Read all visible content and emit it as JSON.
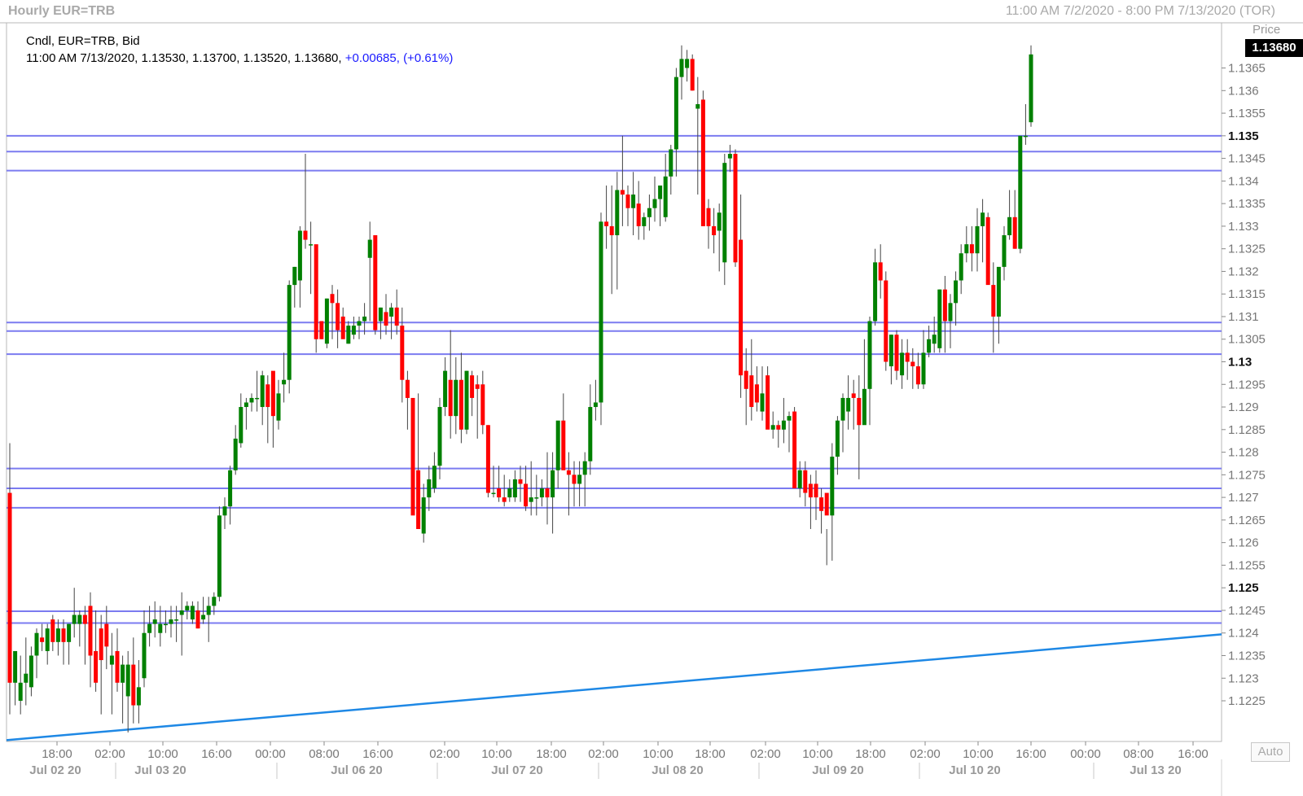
{
  "header": {
    "title": "Hourly EUR=TRB",
    "range": "11:00 AM 7/2/2020 - 8:00 PM 7/13/2020 (TOR)"
  },
  "legend": {
    "line1": "Cndl, EUR=TRB, Bid",
    "line2_prefix": "11:00 AM 7/13/2020, 1.13530, 1.13700, 1.13520, 1.13680,",
    "change": "+0.00685,",
    "change_pct": "(+0.61%)"
  },
  "axis": {
    "price_label": "Price",
    "last_price": "1.13680",
    "auto_button": "Auto"
  },
  "colors": {
    "up": "#008000",
    "down": "#ff0000",
    "hline": "#7b7bf0",
    "trendline": "#1e88e5"
  },
  "chart_data": {
    "type": "candlestick",
    "symbol": "EUR=TRB",
    "interval": "Hourly",
    "ylim": [
      1.1216,
      1.1375
    ],
    "y_ticks": [
      {
        "v": 1.1225,
        "label": "1.1225",
        "bold": false
      },
      {
        "v": 1.123,
        "label": "1.123",
        "bold": false
      },
      {
        "v": 1.1235,
        "label": "1.1235",
        "bold": false
      },
      {
        "v": 1.124,
        "label": "1.124",
        "bold": false
      },
      {
        "v": 1.1245,
        "label": "1.1245",
        "bold": false
      },
      {
        "v": 1.125,
        "label": "1.125",
        "bold": true
      },
      {
        "v": 1.1255,
        "label": "1.1255",
        "bold": false
      },
      {
        "v": 1.126,
        "label": "1.126",
        "bold": false
      },
      {
        "v": 1.1265,
        "label": "1.1265",
        "bold": false
      },
      {
        "v": 1.127,
        "label": "1.127",
        "bold": false
      },
      {
        "v": 1.1275,
        "label": "1.1275",
        "bold": false
      },
      {
        "v": 1.128,
        "label": "1.128",
        "bold": false
      },
      {
        "v": 1.1285,
        "label": "1.1285",
        "bold": false
      },
      {
        "v": 1.129,
        "label": "1.129",
        "bold": false
      },
      {
        "v": 1.1295,
        "label": "1.1295",
        "bold": false
      },
      {
        "v": 1.13,
        "label": "1.13",
        "bold": true
      },
      {
        "v": 1.1305,
        "label": "1.1305",
        "bold": false
      },
      {
        "v": 1.131,
        "label": "1.131",
        "bold": false
      },
      {
        "v": 1.1315,
        "label": "1.1315",
        "bold": false
      },
      {
        "v": 1.132,
        "label": "1.132",
        "bold": false
      },
      {
        "v": 1.1325,
        "label": "1.1325",
        "bold": false
      },
      {
        "v": 1.133,
        "label": "1.133",
        "bold": false
      },
      {
        "v": 1.1335,
        "label": "1.1335",
        "bold": false
      },
      {
        "v": 1.134,
        "label": "1.134",
        "bold": false
      },
      {
        "v": 1.1345,
        "label": "1.1345",
        "bold": false
      },
      {
        "v": 1.135,
        "label": "1.135",
        "bold": true
      },
      {
        "v": 1.1355,
        "label": "1.1355",
        "bold": false
      },
      {
        "v": 1.136,
        "label": "1.136",
        "bold": false
      },
      {
        "v": 1.1365,
        "label": "1.1365",
        "bold": false
      }
    ],
    "x_time_labels": [
      "18:00",
      "02:00",
      "10:00",
      "16:00",
      "00:00",
      "08:00",
      "16:00",
      "02:00",
      "10:00",
      "18:00",
      "02:00",
      "10:00",
      "18:00",
      "02:00",
      "10:00",
      "18:00",
      "02:00",
      "10:00",
      "16:00",
      "00:00",
      "08:00",
      "16:00"
    ],
    "x_date_labels": [
      "Jul 02 20",
      "Jul 03 20",
      "Jul 06 20",
      "Jul 07 20",
      "Jul 08 20",
      "Jul 09 20",
      "Jul 10 20",
      "Jul 13 20"
    ],
    "horizontal_levels": [
      1.135,
      1.13465,
      1.13423,
      1.13087,
      1.13068,
      1.13017,
      1.12764,
      1.1272,
      1.12677,
      1.12448,
      1.12422
    ],
    "trendline": {
      "start": 1.12163,
      "end": 1.12397
    },
    "candles": [
      [
        1.1271,
        1.1282,
        1.1222,
        1.1229
      ],
      [
        1.1229,
        1.1233,
        1.1224,
        1.1236
      ],
      [
        1.1225,
        1.1235,
        1.1222,
        1.1229
      ],
      [
        1.1229,
        1.1239,
        1.1224,
        1.1231
      ],
      [
        1.1228,
        1.1237,
        1.1226,
        1.1235
      ],
      [
        1.1235,
        1.1241,
        1.123,
        1.124
      ],
      [
        1.1239,
        1.1242,
        1.1236,
        1.1238
      ],
      [
        1.1236,
        1.1242,
        1.1233,
        1.1241
      ],
      [
        1.1243,
        1.1244,
        1.1236,
        1.1238
      ],
      [
        1.1238,
        1.1243,
        1.1235,
        1.1241
      ],
      [
        1.1241,
        1.1243,
        1.1233,
        1.1238
      ],
      [
        1.1238,
        1.1242,
        1.1233,
        1.1242
      ],
      [
        1.1242,
        1.125,
        1.1239,
        1.1244
      ],
      [
        1.1242,
        1.1245,
        1.1237,
        1.1244
      ],
      [
        1.1244,
        1.1246,
        1.1233,
        1.1242
      ],
      [
        1.1246,
        1.1249,
        1.1228,
        1.1235
      ],
      [
        1.1236,
        1.1245,
        1.1227,
        1.1229
      ],
      [
        1.1241,
        1.1244,
        1.1222,
        1.1234
      ],
      [
        1.1242,
        1.1246,
        1.1232,
        1.1237
      ],
      [
        1.1233,
        1.124,
        1.1222,
        1.1235
      ],
      [
        1.1236,
        1.1241,
        1.1227,
        1.1229
      ],
      [
        1.1229,
        1.1235,
        1.122,
        1.1233
      ],
      [
        1.1226,
        1.1236,
        1.1218,
        1.1233
      ],
      [
        1.1233,
        1.1239,
        1.122,
        1.1224
      ],
      [
        1.1224,
        1.1234,
        1.122,
        1.1228
      ],
      [
        1.123,
        1.1245,
        1.1228,
        1.124
      ],
      [
        1.124,
        1.1246,
        1.1237,
        1.1242
      ],
      [
        1.1242,
        1.1247,
        1.1239,
        1.1243
      ],
      [
        1.124,
        1.1246,
        1.1237,
        1.1242
      ],
      [
        1.1242,
        1.1245,
        1.124,
        1.1242
      ],
      [
        1.1242,
        1.1246,
        1.1239,
        1.1243
      ],
      [
        1.1243,
        1.1246,
        1.1238,
        1.1243
      ],
      [
        1.1244,
        1.1249,
        1.1235,
        1.1245
      ],
      [
        1.1245,
        1.1247,
        1.1243,
        1.1246
      ],
      [
        1.1243,
        1.1247,
        1.1242,
        1.1246
      ],
      [
        1.1245,
        1.1247,
        1.1241,
        1.1241
      ],
      [
        1.1243,
        1.1248,
        1.1242,
        1.1244
      ],
      [
        1.1244,
        1.1248,
        1.1238,
        1.1246
      ],
      [
        1.1246,
        1.1249,
        1.1244,
        1.1248
      ],
      [
        1.1248,
        1.1268,
        1.1247,
        1.1266
      ],
      [
        1.1266,
        1.127,
        1.1263,
        1.1268
      ],
      [
        1.1268,
        1.1277,
        1.1264,
        1.1276
      ],
      [
        1.1276,
        1.1286,
        1.1275,
        1.1283
      ],
      [
        1.1282,
        1.1293,
        1.1281,
        1.129
      ],
      [
        1.129,
        1.1292,
        1.1285,
        1.1291
      ],
      [
        1.1291,
        1.1293,
        1.1289,
        1.1292
      ],
      [
        1.1292,
        1.1298,
        1.1289,
        1.1292
      ],
      [
        1.129,
        1.1298,
        1.1286,
        1.1297
      ],
      [
        1.1295,
        1.1297,
        1.1282,
        1.129
      ],
      [
        1.1298,
        1.1295,
        1.1281,
        1.1288
      ],
      [
        1.1287,
        1.1296,
        1.1285,
        1.1293
      ],
      [
        1.1295,
        1.1302,
        1.1291,
        1.1296
      ],
      [
        1.1296,
        1.1318,
        1.1293,
        1.1317
      ],
      [
        1.1317,
        1.1321,
        1.1312,
        1.1321
      ],
      [
        1.1318,
        1.133,
        1.1312,
        1.1329
      ],
      [
        1.1329,
        1.1346,
        1.1325,
        1.1327
      ],
      [
        1.1326,
        1.1331,
        1.1315,
        1.1326
      ],
      [
        1.1326,
        1.131,
        1.1302,
        1.1305
      ],
      [
        1.1309,
        1.1309,
        1.1305,
        1.1305
      ],
      [
        1.1304,
        1.1314,
        1.1303,
        1.1314
      ],
      [
        1.1315,
        1.1317,
        1.1305,
        1.1313
      ],
      [
        1.1313,
        1.1316,
        1.1303,
        1.1307
      ],
      [
        1.131,
        1.1312,
        1.1306,
        1.1305
      ],
      [
        1.1304,
        1.1309,
        1.1304,
        1.1308
      ],
      [
        1.1306,
        1.131,
        1.1305,
        1.1308
      ],
      [
        1.1308,
        1.131,
        1.1305,
        1.1309
      ],
      [
        1.1309,
        1.1313,
        1.1306,
        1.131
      ],
      [
        1.1323,
        1.1331,
        1.1309,
        1.1327
      ],
      [
        1.1328,
        1.1326,
        1.1306,
        1.1307
      ],
      [
        1.1309,
        1.1312,
        1.1305,
        1.1312
      ],
      [
        1.1311,
        1.1315,
        1.1306,
        1.1308
      ],
      [
        1.131,
        1.1313,
        1.1305,
        1.1312
      ],
      [
        1.1312,
        1.1316,
        1.1306,
        1.1308
      ],
      [
        1.1308,
        1.1312,
        1.1291,
        1.1296
      ],
      [
        1.1296,
        1.1298,
        1.1285,
        1.1292
      ],
      [
        1.1292,
        1.1287,
        1.1268,
        1.1266
      ],
      [
        1.1276,
        1.1293,
        1.1266,
        1.1263
      ],
      [
        1.1262,
        1.1273,
        1.126,
        1.127
      ],
      [
        1.127,
        1.1277,
        1.1267,
        1.1274
      ],
      [
        1.1272,
        1.128,
        1.1271,
        1.1277
      ],
      [
        1.1277,
        1.1292,
        1.1274,
        1.129
      ],
      [
        1.129,
        1.1301,
        1.1288,
        1.1298
      ],
      [
        1.1296,
        1.1307,
        1.1283,
        1.1288
      ],
      [
        1.1288,
        1.1301,
        1.1284,
        1.1296
      ],
      [
        1.1296,
        1.1302,
        1.1282,
        1.1285
      ],
      [
        1.1285,
        1.1298,
        1.1284,
        1.1298
      ],
      [
        1.1297,
        1.1298,
        1.1288,
        1.1292
      ],
      [
        1.1295,
        1.1297,
        1.1283,
        1.1294
      ],
      [
        1.1295,
        1.1298,
        1.1284,
        1.1286
      ],
      [
        1.1286,
        1.1286,
        1.127,
        1.1271
      ],
      [
        1.1271,
        1.1277,
        1.127,
        1.1271
      ],
      [
        1.1272,
        1.1277,
        1.1269,
        1.127
      ],
      [
        1.127,
        1.1275,
        1.1268,
        1.1269
      ],
      [
        1.127,
        1.1274,
        1.1269,
        1.1272
      ],
      [
        1.127,
        1.1276,
        1.1269,
        1.1274
      ],
      [
        1.1274,
        1.1277,
        1.1269,
        1.1273
      ],
      [
        1.1273,
        1.1277,
        1.1267,
        1.1268
      ],
      [
        1.1269,
        1.1278,
        1.1266,
        1.127
      ],
      [
        1.127,
        1.1275,
        1.1266,
        1.127
      ],
      [
        1.127,
        1.1274,
        1.1268,
        1.1272
      ],
      [
        1.1272,
        1.128,
        1.1264,
        1.127
      ],
      [
        1.127,
        1.128,
        1.1262,
        1.1276
      ],
      [
        1.1276,
        1.1285,
        1.1272,
        1.1287
      ],
      [
        1.1287,
        1.1293,
        1.128,
        1.1276
      ],
      [
        1.1276,
        1.128,
        1.1266,
        1.1275
      ],
      [
        1.1275,
        1.1278,
        1.1268,
        1.1273
      ],
      [
        1.1273,
        1.1278,
        1.1268,
        1.1275
      ],
      [
        1.1275,
        1.128,
        1.1268,
        1.1278
      ],
      [
        1.1278,
        1.1295,
        1.1275,
        1.129
      ],
      [
        1.129,
        1.1296,
        1.1287,
        1.1291
      ],
      [
        1.1291,
        1.1333,
        1.1286,
        1.1331
      ],
      [
        1.1331,
        1.1339,
        1.1325,
        1.133
      ],
      [
        1.133,
        1.1339,
        1.1315,
        1.1328
      ],
      [
        1.1328,
        1.1342,
        1.1316,
        1.1338
      ],
      [
        1.1338,
        1.135,
        1.133,
        1.1337
      ],
      [
        1.1337,
        1.1339,
        1.133,
        1.1334
      ],
      [
        1.1334,
        1.1342,
        1.1328,
        1.1337
      ],
      [
        1.1335,
        1.134,
        1.1327,
        1.133
      ],
      [
        1.133,
        1.1333,
        1.1327,
        1.1332
      ],
      [
        1.1332,
        1.1337,
        1.1329,
        1.1334
      ],
      [
        1.1334,
        1.1341,
        1.1331,
        1.1336
      ],
      [
        1.1336,
        1.1338,
        1.133,
        1.1339
      ],
      [
        1.1332,
        1.1346,
        1.1331,
        1.1341
      ],
      [
        1.1341,
        1.1348,
        1.1337,
        1.1347
      ],
      [
        1.1347,
        1.1365,
        1.1341,
        1.1363
      ],
      [
        1.1363,
        1.137,
        1.1358,
        1.1367
      ],
      [
        1.1365,
        1.1369,
        1.1362,
        1.1367
      ],
      [
        1.1367,
        1.1368,
        1.136,
        1.136
      ],
      [
        1.1356,
        1.1363,
        1.1337,
        1.1357
      ],
      [
        1.1358,
        1.136,
        1.134,
        1.133
      ],
      [
        1.1334,
        1.1336,
        1.1325,
        1.133
      ],
      [
        1.133,
        1.1334,
        1.1324,
        1.1328
      ],
      [
        1.1329,
        1.1335,
        1.132,
        1.1333
      ],
      [
        1.1322,
        1.1346,
        1.1317,
        1.1344
      ],
      [
        1.1345,
        1.1348,
        1.1342,
        1.1346
      ],
      [
        1.1346,
        1.1347,
        1.1321,
        1.1322
      ],
      [
        1.1327,
        1.1337,
        1.1292,
        1.1297
      ],
      [
        1.1298,
        1.1303,
        1.1286,
        1.1294
      ],
      [
        1.1297,
        1.1305,
        1.1287,
        1.129
      ],
      [
        1.1295,
        1.1299,
        1.1289,
        1.1291
      ],
      [
        1.1289,
        1.1299,
        1.1287,
        1.1293
      ],
      [
        1.1297,
        1.1299,
        1.1286,
        1.1285
      ],
      [
        1.1285,
        1.1289,
        1.1283,
        1.1286
      ],
      [
        1.1286,
        1.1287,
        1.1281,
        1.1285
      ],
      [
        1.1285,
        1.1292,
        1.1282,
        1.1287
      ],
      [
        1.1287,
        1.1289,
        1.128,
        1.1288
      ],
      [
        1.1289,
        1.129,
        1.1275,
        1.1272
      ],
      [
        1.1272,
        1.1278,
        1.127,
        1.1276
      ],
      [
        1.1276,
        1.1278,
        1.1268,
        1.1271
      ],
      [
        1.1273,
        1.1275,
        1.1263,
        1.127
      ],
      [
        1.1273,
        1.1276,
        1.1265,
        1.127
      ],
      [
        1.127,
        1.1272,
        1.1262,
        1.1267
      ],
      [
        1.1271,
        1.1263,
        1.1255,
        1.1266
      ],
      [
        1.1266,
        1.1282,
        1.1256,
        1.1279
      ],
      [
        1.1279,
        1.1288,
        1.1275,
        1.1287
      ],
      [
        1.1287,
        1.1293,
        1.128,
        1.1292
      ],
      [
        1.1289,
        1.1297,
        1.1285,
        1.1292
      ],
      [
        1.1293,
        1.1296,
        1.1285,
        1.1292
      ],
      [
        1.1292,
        1.1297,
        1.1274,
        1.1286
      ],
      [
        1.1286,
        1.1305,
        1.129,
        1.1294
      ],
      [
        1.1294,
        1.131,
        1.1286,
        1.1309
      ],
      [
        1.1309,
        1.1325,
        1.1308,
        1.1322
      ],
      [
        1.1322,
        1.1326,
        1.1314,
        1.1318
      ],
      [
        1.1318,
        1.132,
        1.1298,
        1.13
      ],
      [
        1.1299,
        1.1306,
        1.1295,
        1.1306
      ],
      [
        1.1306,
        1.1307,
        1.1296,
        1.1298
      ],
      [
        1.1297,
        1.1305,
        1.1294,
        1.1302
      ],
      [
        1.1302,
        1.1305,
        1.1296,
        1.13
      ],
      [
        1.13,
        1.1303,
        1.1294,
        1.1299
      ],
      [
        1.1299,
        1.1302,
        1.1294,
        1.1295
      ],
      [
        1.1295,
        1.1307,
        1.1294,
        1.1302
      ],
      [
        1.1302,
        1.1308,
        1.1301,
        1.1305
      ],
      [
        1.1304,
        1.131,
        1.1302,
        1.1306
      ],
      [
        1.1303,
        1.1316,
        1.1302,
        1.1316
      ],
      [
        1.1316,
        1.1319,
        1.1302,
        1.1309
      ],
      [
        1.1309,
        1.1315,
        1.1303,
        1.1313
      ],
      [
        1.1313,
        1.132,
        1.1308,
        1.1318
      ],
      [
        1.1318,
        1.1326,
        1.1315,
        1.1324
      ],
      [
        1.1324,
        1.133,
        1.1322,
        1.1326
      ],
      [
        1.1326,
        1.133,
        1.132,
        1.1324
      ],
      [
        1.1324,
        1.1334,
        1.132,
        1.133
      ],
      [
        1.133,
        1.1336,
        1.1322,
        1.1333
      ],
      [
        1.1332,
        1.1333,
        1.1326,
        1.1317
      ],
      [
        1.1317,
        1.1322,
        1.1302,
        1.131
      ],
      [
        1.131,
        1.1316,
        1.1304,
        1.1321
      ],
      [
        1.1321,
        1.133,
        1.1318,
        1.1328
      ],
      [
        1.1328,
        1.1338,
        1.1327,
        1.1332
      ],
      [
        1.1332,
        1.1338,
        1.1325,
        1.1325
      ],
      [
        1.1325,
        1.1337,
        1.1324,
        1.135
      ],
      [
        1.135,
        1.1357,
        1.1348,
        1.135
      ],
      [
        1.1353,
        1.137,
        1.1352,
        1.1368
      ]
    ]
  }
}
